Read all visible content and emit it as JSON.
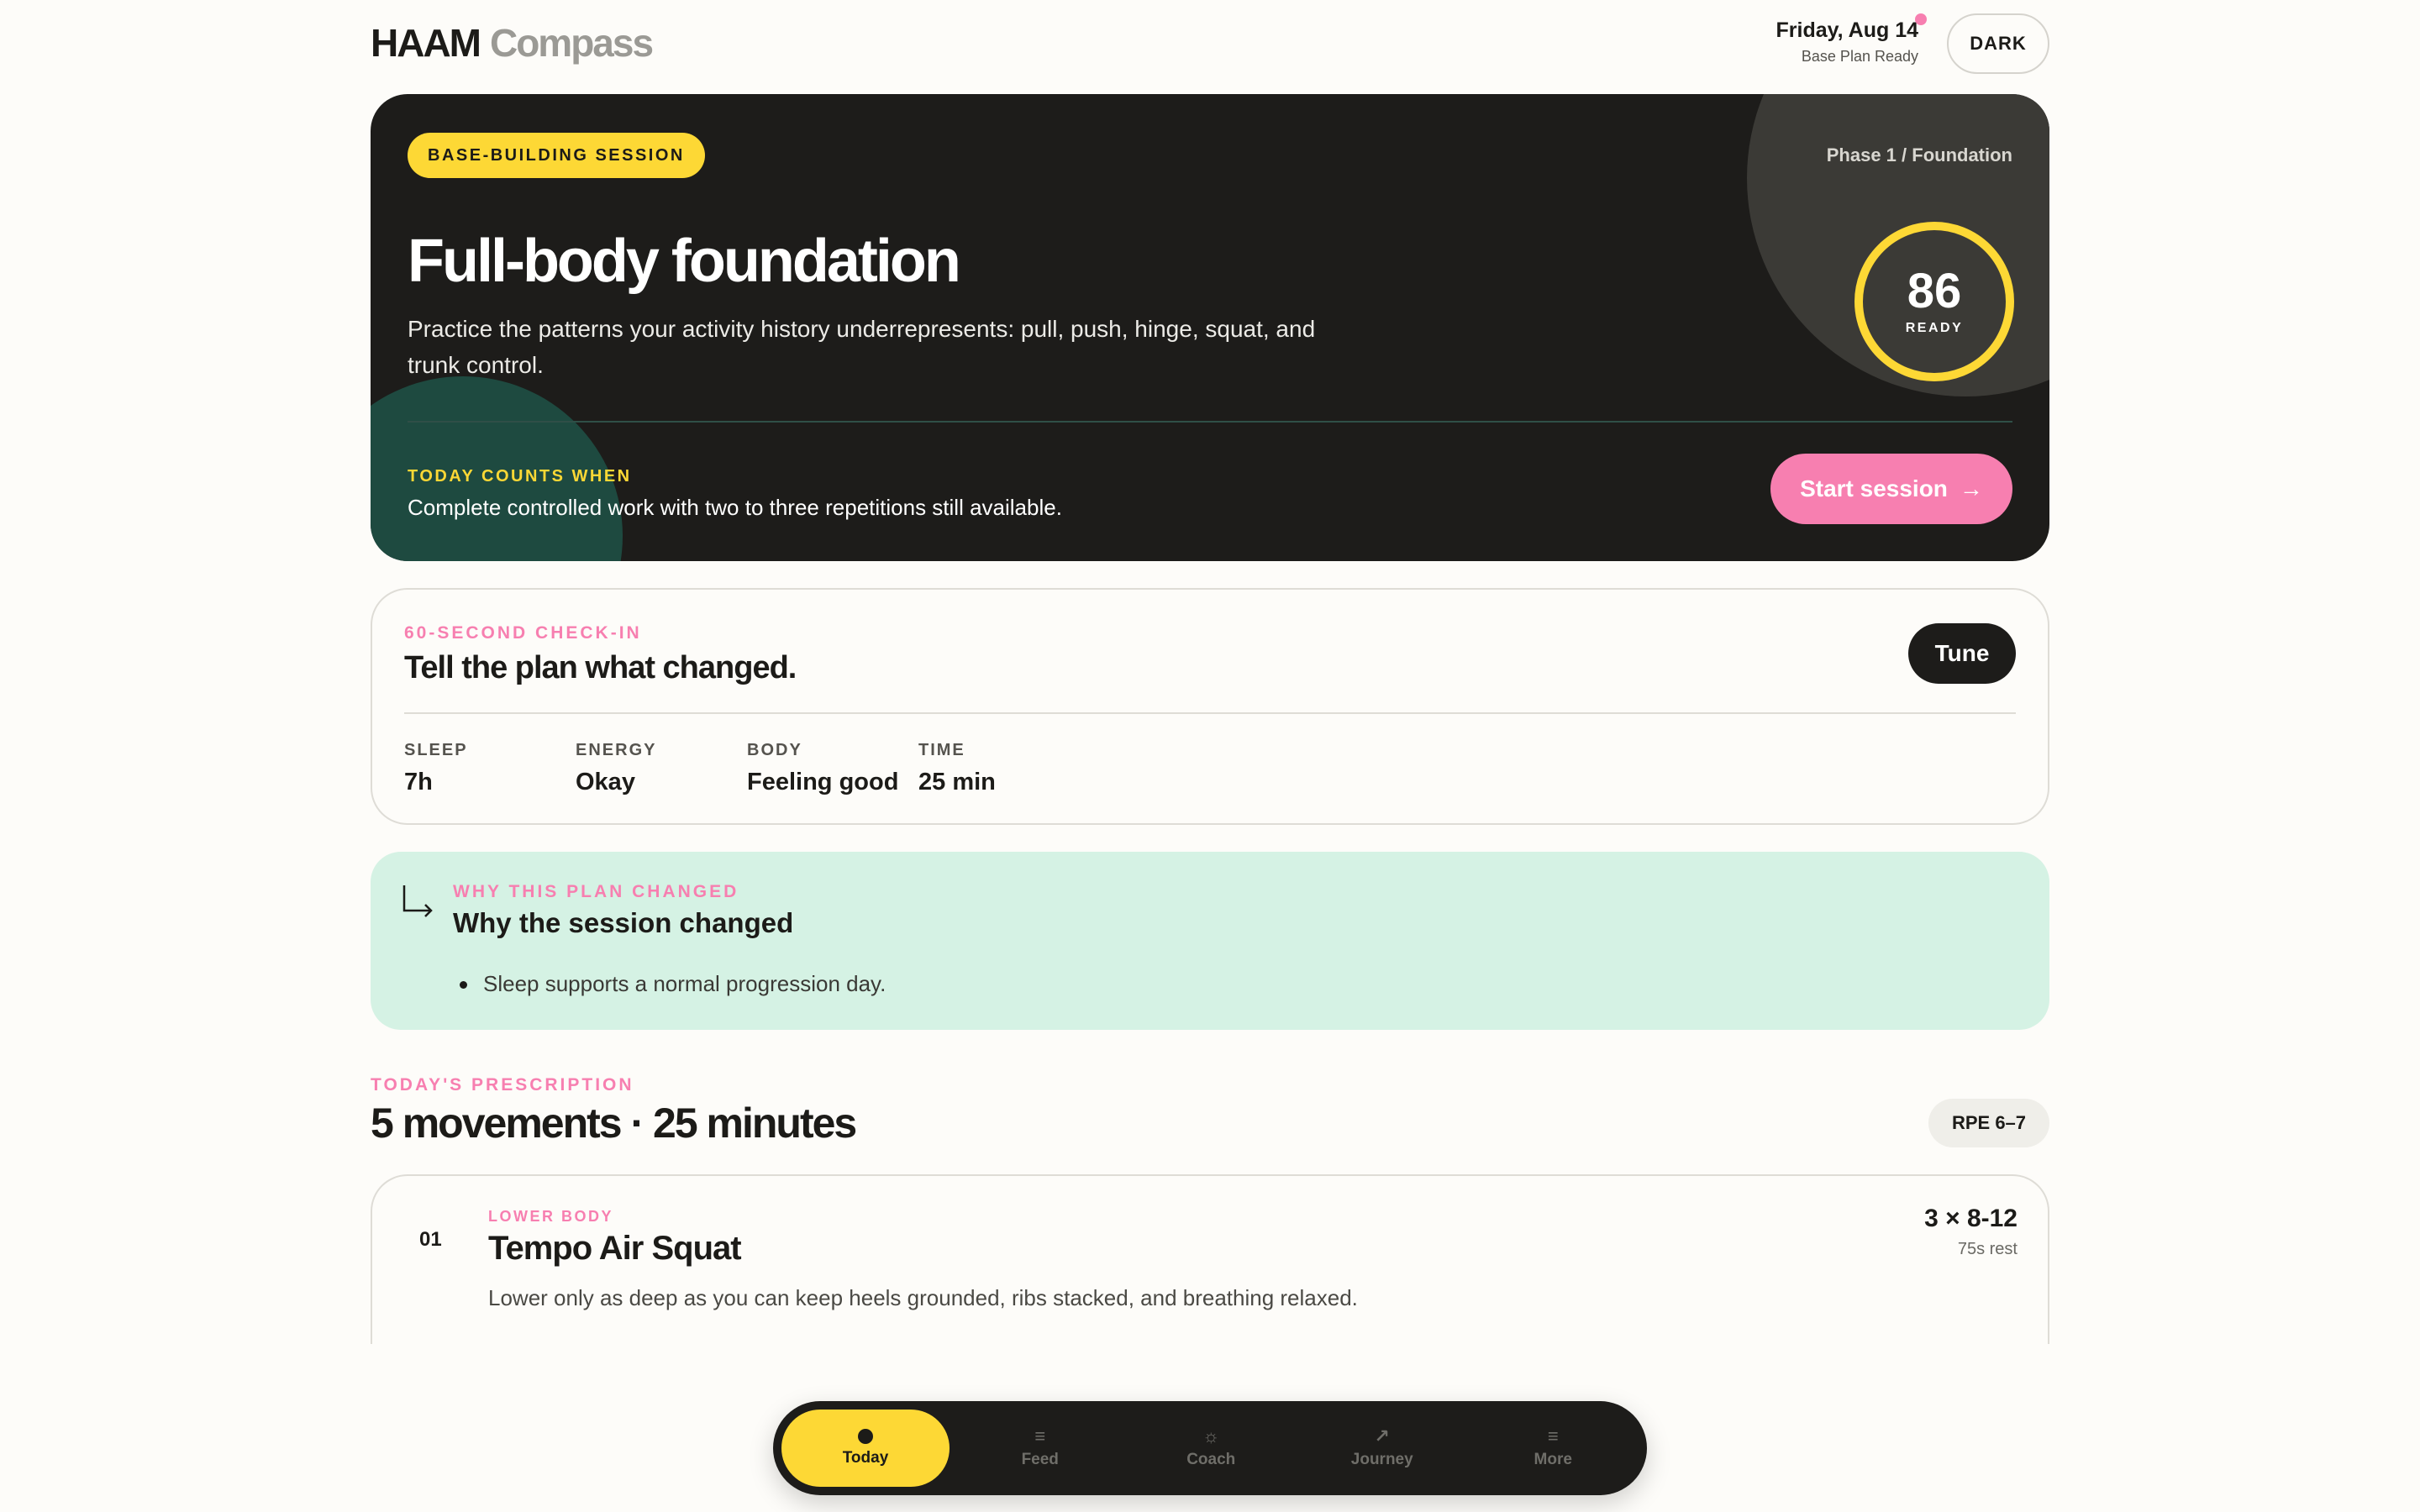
{
  "header": {
    "brand": "HAAM",
    "product": "Compass",
    "date": "Friday, Aug 14",
    "status": "Base Plan Ready",
    "theme_toggle": "DARK"
  },
  "hero": {
    "badge": "BASE-BUILDING SESSION",
    "phase": "Phase 1 / Foundation",
    "title": "Full-body foundation",
    "description": "Practice the patterns your activity history underrepresents: pull, push, hinge, squat, and trunk control.",
    "readiness": {
      "score": "86",
      "label": "READY",
      "fraction": 0.86
    },
    "counts_label": "TODAY COUNTS WHEN",
    "counts_text": "Complete controlled work with two to three repetitions still available.",
    "start_button": "Start session",
    "start_arrow": "→"
  },
  "checkin": {
    "eyebrow": "60-SECOND CHECK-IN",
    "title": "Tell the plan what changed.",
    "tune_button": "Tune",
    "metrics": [
      {
        "label": "SLEEP",
        "value": "7h"
      },
      {
        "label": "ENERGY",
        "value": "Okay"
      },
      {
        "label": "BODY",
        "value": "Feeling good"
      },
      {
        "label": "TIME",
        "value": "25 min"
      }
    ]
  },
  "why": {
    "eyebrow": "WHY THIS PLAN CHANGED",
    "title": "Why the session changed",
    "reasons": [
      "Sleep supports a normal progression day."
    ]
  },
  "prescription": {
    "eyebrow": "TODAY'S PRESCRIPTION",
    "title": "5 movements · 25 minutes",
    "rpe": "RPE 6–7",
    "movements": [
      {
        "number": "01",
        "category": "LOWER BODY",
        "name": "Tempo Air Squat",
        "description": "Lower only as deep as you can keep heels grounded, ribs stacked, and breathing relaxed.",
        "sets": "3 × 8-12",
        "rest": "75s rest"
      }
    ]
  },
  "nav": {
    "items": [
      {
        "label": "Today",
        "icon": "dot-icon",
        "active": true
      },
      {
        "label": "Feed",
        "icon": "menu-icon",
        "glyph": "≡"
      },
      {
        "label": "Coach",
        "icon": "sun-icon",
        "glyph": "☼"
      },
      {
        "label": "Journey",
        "icon": "arrow-up-right-icon",
        "glyph": "↗"
      },
      {
        "label": "More",
        "icon": "menu-icon",
        "glyph": "≡"
      }
    ]
  },
  "colors": {
    "accent_yellow": "#fdd835",
    "accent_pink": "#f77fb0",
    "dark": "#1d1c1a",
    "mint": "#d5f2e4"
  }
}
